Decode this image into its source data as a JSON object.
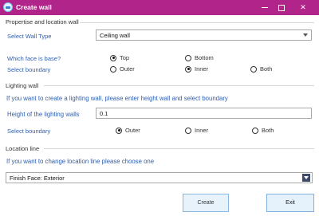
{
  "window": {
    "title": "Create wall"
  },
  "properties_section": {
    "title": "Propertise and location wall",
    "wall_type_label": "Select Wall Type",
    "wall_type_value": "Ceiling wall",
    "base_face_label": "Which face is base?",
    "base_face_options": [
      "Top",
      "Bottom"
    ],
    "base_face_selected": "Top",
    "boundary_label": "Select boundary",
    "boundary_options": [
      "Outer",
      "Inner",
      "Both"
    ],
    "boundary_selected": "Inner"
  },
  "lighting_section": {
    "title": "Lighting wall",
    "instruction": "If you want to create a lighting wall, please enter height wall and select boundary",
    "height_label": "Height of the lighting walls",
    "height_value": "0.1",
    "boundary_label": "Select boundary",
    "boundary_options": [
      "Outer",
      "Inner",
      "Both"
    ],
    "boundary_selected": "Outer"
  },
  "location_section": {
    "title": "Location line",
    "instruction": "If  you want to change location line please choose one",
    "location_value": "Finish Face: Exterior"
  },
  "buttons": {
    "create": "Create",
    "exit": "Exit"
  },
  "colors": {
    "titlebar": "#b1248a",
    "label_blue": "#2f5fb0",
    "button_fill": "#e5f1fb",
    "button_border": "#7fb0e0"
  }
}
